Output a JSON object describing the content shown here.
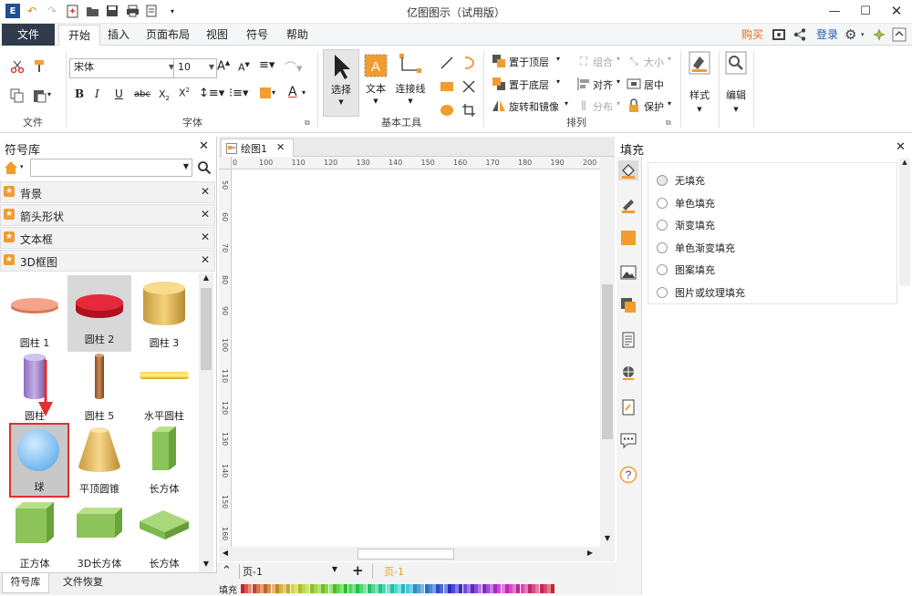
{
  "app": {
    "title": "亿图图示（试用版）"
  },
  "menu": {
    "file": "文件",
    "tabs": [
      "开始",
      "插入",
      "页面布局",
      "视图",
      "符号",
      "帮助"
    ],
    "active_tab": "开始",
    "buy": "购买",
    "login": "登录"
  },
  "ribbon": {
    "font_name": "宋体",
    "font_size": "10",
    "group_file": "文件",
    "group_font": "字体",
    "group_tools": "基本工具",
    "group_arrange": "排列",
    "btn_select": "选择",
    "btn_text": "文本",
    "btn_connector": "连接线",
    "btn_bring_front": "置于顶层",
    "btn_send_back": "置于底层",
    "btn_rotate_mirror": "旋转和镜像",
    "btn_group": "组合",
    "btn_align": "对齐",
    "btn_distribute": "分布",
    "btn_size": "大小",
    "btn_center": "居中",
    "btn_protect": "保护",
    "btn_style": "样式",
    "btn_edit": "编辑"
  },
  "library": {
    "title": "符号库",
    "search_value": "",
    "categories": [
      "背景",
      "箭头形状",
      "文本框",
      "3D框图"
    ],
    "shapes": [
      {
        "label": "圆柱 1"
      },
      {
        "label": "圆柱 2"
      },
      {
        "label": "圆柱 3"
      },
      {
        "label": "圆柱"
      },
      {
        "label": "圆柱 5"
      },
      {
        "label": "水平圆柱"
      },
      {
        "label": "球"
      },
      {
        "label": "平顶圆锥"
      },
      {
        "label": "长方体"
      },
      {
        "label": "正方体"
      },
      {
        "label": "3D长方体"
      },
      {
        "label": "长方体"
      }
    ],
    "bottom_tabs": [
      "符号库",
      "文件恢复"
    ]
  },
  "document": {
    "tab_label": "绘图1",
    "ruler_h": [
      "0",
      "100",
      "110",
      "120",
      "130",
      "140",
      "150",
      "160",
      "170",
      "180",
      "190",
      "200"
    ],
    "ruler_v": [
      "50",
      "60",
      "70",
      "80",
      "90",
      "100",
      "110",
      "120",
      "130",
      "140",
      "150",
      "160"
    ],
    "page_selector": "页-1",
    "current_page": "页-1",
    "fill_label": "填充"
  },
  "fill_panel": {
    "title": "填充",
    "options": [
      "无填充",
      "单色填充",
      "渐变填充",
      "单色渐变填充",
      "图案填充",
      "图片或纹理填充"
    ],
    "selected": "无填充"
  },
  "colors": {
    "menu_file_bg": "#2f3b4b",
    "accent_orange": "#f29c2e",
    "highlight_red": "#e03030",
    "buy_color": "#e46b1a"
  }
}
